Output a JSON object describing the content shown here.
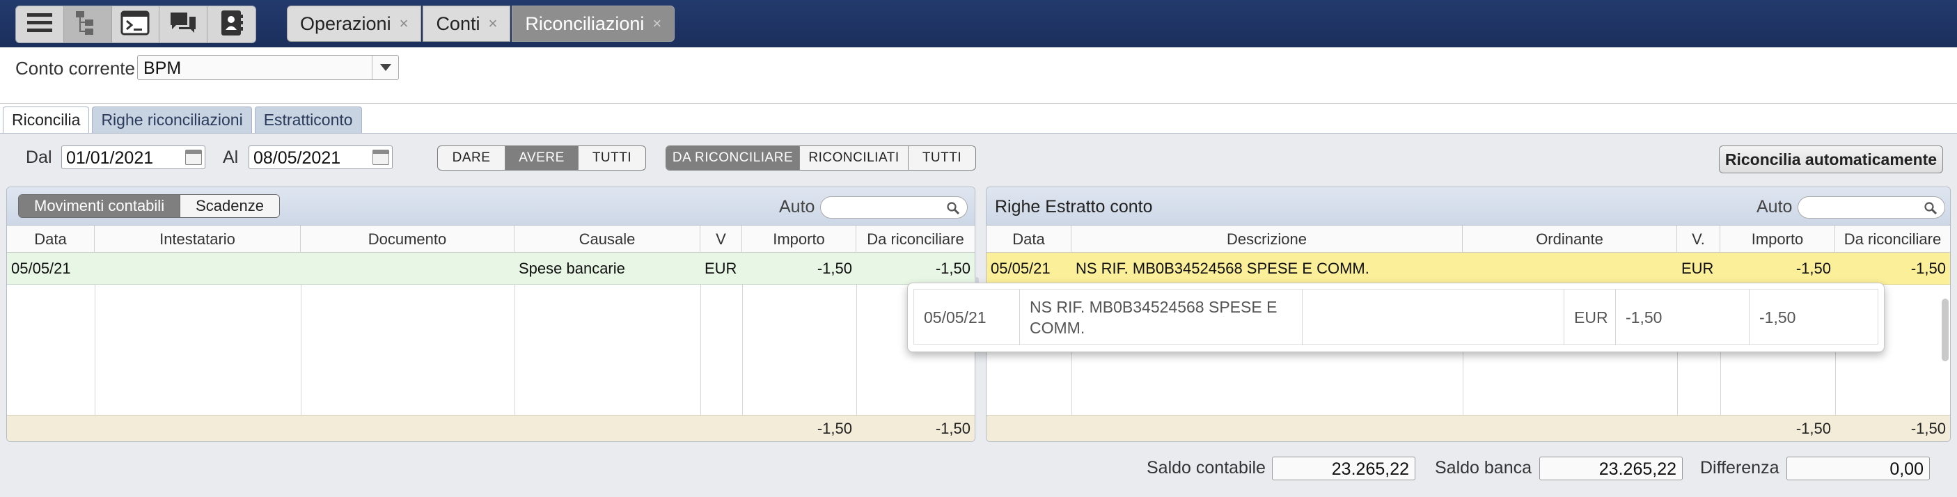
{
  "toolbar": {
    "tools": [
      {
        "name": "menu-icon"
      },
      {
        "name": "tree-icon"
      },
      {
        "name": "terminal-icon"
      },
      {
        "name": "chat-icon"
      },
      {
        "name": "contacts-icon"
      }
    ]
  },
  "tabs": [
    {
      "label": "Operazioni",
      "close": "×"
    },
    {
      "label": "Conti",
      "close": "×"
    },
    {
      "label": "Riconciliazioni",
      "close": "×",
      "active": true
    }
  ],
  "account": {
    "label": "Conto corrente",
    "value": "BPM"
  },
  "section_tabs": [
    {
      "label": "Riconcilia",
      "active": true
    },
    {
      "label": "Righe riconciliazioni"
    },
    {
      "label": "Estratticonto"
    }
  ],
  "filters": {
    "from_label": "Dal",
    "from_value": "01/01/2021",
    "to_label": "Al",
    "to_value": "08/05/2021",
    "type_options": [
      "Dare",
      "Avere",
      "Tutti"
    ],
    "type_selected": "Avere",
    "status_options": [
      "Da riconciliare",
      "Riconciliati",
      "Tutti"
    ],
    "status_selected": "Da riconciliare",
    "auto_button": "Riconcilia automaticamente"
  },
  "left_panel": {
    "segments": [
      "Movimenti contabili",
      "Scadenze"
    ],
    "segment_selected": "Movimenti contabili",
    "auto_label": "Auto",
    "columns": [
      "Data",
      "Intestatario",
      "Documento",
      "Causale",
      "V",
      "Importo",
      "Da riconciliare"
    ],
    "rows": [
      {
        "data": "05/05/21",
        "intestatario": "",
        "documento": "",
        "causale": "Spese bancarie",
        "v": "EUR",
        "importo": "-1,50",
        "da_riconciliare": "-1,50"
      }
    ],
    "totals": {
      "importo": "-1,50",
      "da_riconciliare": "-1,50"
    }
  },
  "right_panel": {
    "title": "Righe Estratto conto",
    "auto_label": "Auto",
    "columns": [
      "Data",
      "Descrizione",
      "Ordinante",
      "V.",
      "Importo",
      "Da riconciliare"
    ],
    "rows": [
      {
        "data": "05/05/21",
        "descrizione": "NS RIF. MB0B34524568 SPESE E COMM.",
        "ordinante": "",
        "v": "EUR",
        "importo": "-1,50",
        "da_riconciliare": "-1,50"
      }
    ],
    "totals": {
      "importo": "-1,50",
      "da_riconciliare": "-1,50"
    }
  },
  "drag_preview": {
    "data": "05/05/21",
    "descrizione": "NS RIF. MB0B34524568 SPESE E COMM.",
    "ordinante": "",
    "v": "EUR",
    "importo": "-1,50",
    "da_riconciliare": "-1,50"
  },
  "summary": {
    "saldo_contabile_label": "Saldo contabile",
    "saldo_contabile": "23.265,22",
    "saldo_banca_label": "Saldo banca",
    "saldo_banca": "23.265,22",
    "differenza_label": "Differenza",
    "differenza": "0,00"
  },
  "colors": {
    "topbar": "#1f3463",
    "left_row_bg": "#e8f6e5",
    "right_row_bg": "#fbef9a",
    "totals_bg": "#f3ecd8",
    "panel_header": "#d4ddeb"
  }
}
